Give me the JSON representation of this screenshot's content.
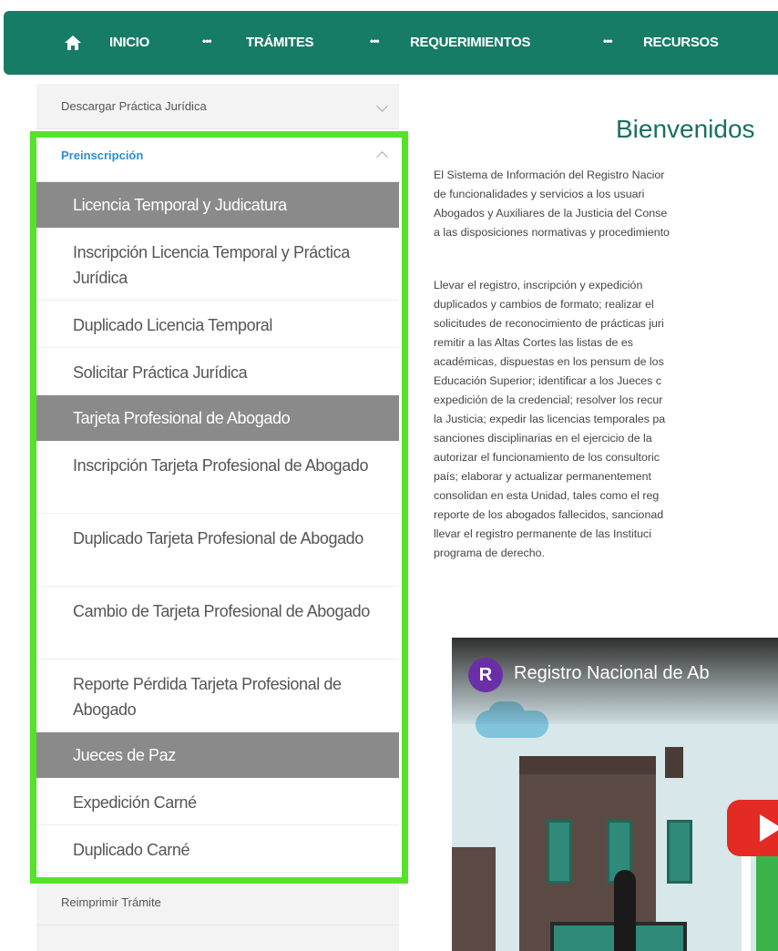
{
  "topnav": {
    "items": [
      {
        "label": "INICIO"
      },
      {
        "label": "TRÁMITES"
      },
      {
        "label": "REQUERIMIENTOS"
      },
      {
        "label": "RECURSOS"
      }
    ],
    "dots": "•••"
  },
  "sidebar": {
    "descargar": "Descargar Práctica Jurídica",
    "preinscripcion": "Preinscripción",
    "groups": [
      {
        "title": "Licencia Temporal y Judicatura",
        "items": [
          "Inscripción Licencia Temporal y Práctica Jurídica",
          "Duplicado Licencia Temporal",
          "Solicitar Práctica Jurídica"
        ]
      },
      {
        "title": "Tarjeta Profesional de Abogado",
        "items": [
          "Inscripción Tarjeta Profesional de Abogado",
          "Duplicado Tarjeta Profesional de Abogado",
          "Cambio de Tarjeta Profesional de Abogado",
          "Reporte Pérdida Tarjeta Profesional de Abogado"
        ]
      },
      {
        "title": "Jueces de Paz",
        "items": [
          "Expedición Carné",
          "Duplicado Carné"
        ]
      }
    ],
    "reimprimir": "Reimprimir Trámite"
  },
  "content": {
    "welcome": "Bienvenidos",
    "p1": [
      "El Sistema de Información del Registro Nacior",
      "de funcionalidades y servicios a los usuari",
      "Abogados y Auxiliares de la Justicia del Conse",
      "a las disposiciones normativas y procedimiento"
    ],
    "p2": [
      "Llevar el registro, inscripción y expedición",
      "duplicados y cambios de formato; realizar el",
      "solicitudes de reconocimiento de prácticas juri",
      "remitir a las Altas Cortes las listas de es",
      "académicas, dispuestas en los pensum de los",
      "Educación Superior; identificar a los Jueces c",
      "expedición de la credencial; resolver los recur",
      "la Justicia; expedir las licencias temporales pa",
      "sanciones disciplinarias en el ejercicio de la",
      "autorizar el funcionamiento de los consultoric",
      "país; elaborar y actualizar permanentement",
      "consolidan en esta Unidad, tales como el reg",
      "reporte de los abogados fallecidos, sancionad",
      "llevar el registro permanente de las Instituci",
      "programa de derecho."
    ],
    "video": {
      "avatar_letter": "R",
      "title": "Registro Nacional de Ab"
    }
  },
  "colors": {
    "nav": "#167c66",
    "highlight": "#55e22b",
    "group": "#8a8a8a",
    "link": "#2a8fd8"
  }
}
